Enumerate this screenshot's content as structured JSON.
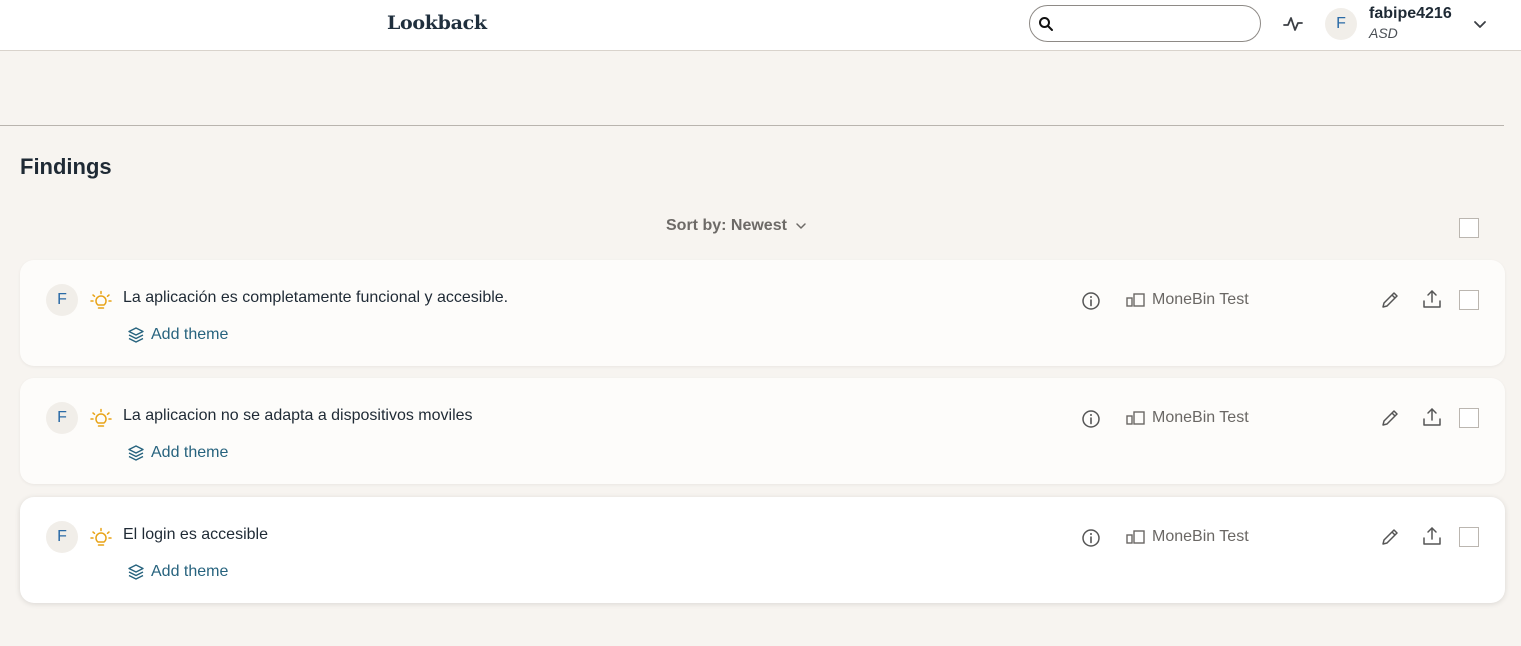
{
  "header": {
    "logo": "Lookback",
    "search_placeholder": "",
    "user": {
      "initial": "F",
      "name": "fabipe4216",
      "org": "ASD"
    }
  },
  "findings": {
    "title": "Findings",
    "sort_label": "Sort by: Newest",
    "items": [
      {
        "initial": "F",
        "title": "La aplicación es completamente funcional y accesible.",
        "add_theme": "Add theme",
        "project": "MoneBin Test"
      },
      {
        "initial": "F",
        "title": "La aplicacion no se adapta a dispositivos moviles",
        "add_theme": "Add theme",
        "project": "MoneBin Test"
      },
      {
        "initial": "F",
        "title": "El login es accesible",
        "add_theme": "Add theme",
        "project": "MoneBin Test"
      }
    ]
  },
  "colors": {
    "background": "#f7f4f0",
    "accent": "#27637e",
    "bulb": "#e8a317",
    "avatar_text": "#2a6aa6"
  }
}
